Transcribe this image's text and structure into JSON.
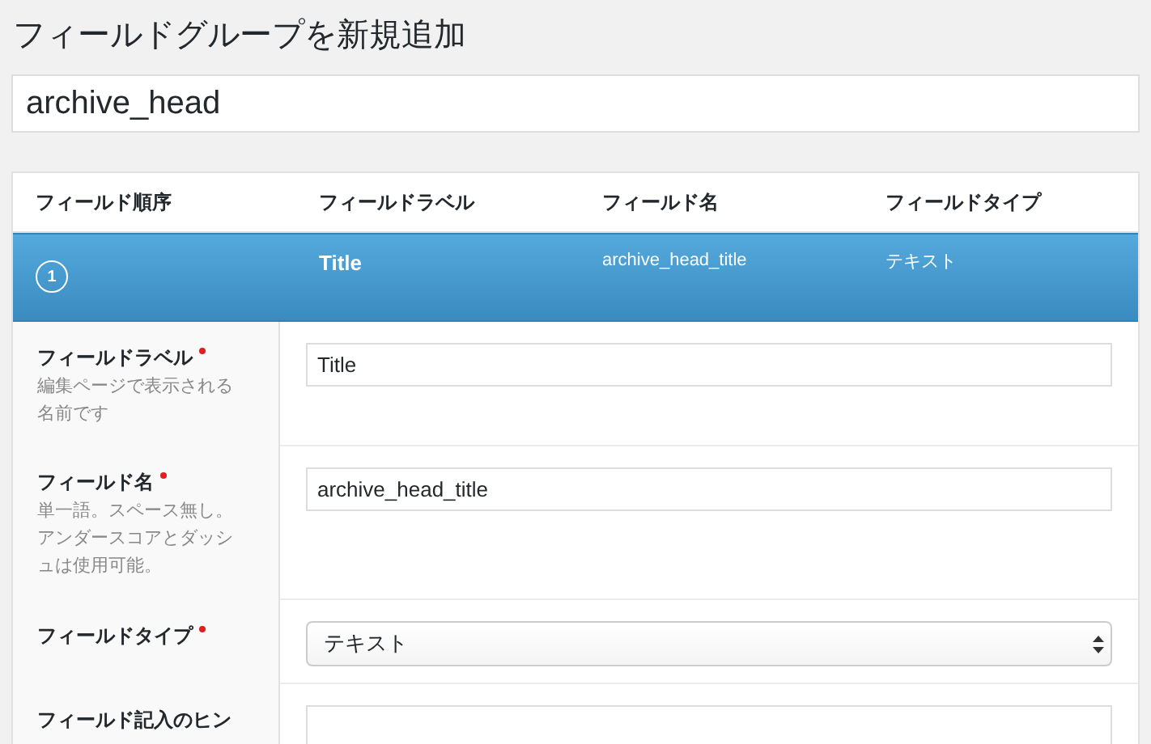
{
  "heading": "フィールドグループを新規追加",
  "group_title": {
    "value": "archive_head"
  },
  "table": {
    "columns": [
      "フィールド順序",
      "フィールドラベル",
      "フィールド名",
      "フィールドタイプ"
    ],
    "field": {
      "order": "1",
      "label": "Title",
      "name": "archive_head_title",
      "type": "テキスト",
      "selected": true
    }
  },
  "form_rows": [
    {
      "kind": "text",
      "label": "フィールドラベル",
      "required": true,
      "description": "編集ページで表示される名前です",
      "value": "Title"
    },
    {
      "kind": "text",
      "label": "フィールド名",
      "required": true,
      "description": "単一語。スペース無し。アンダースコアとダッシュは使用可能。",
      "value": "archive_head_title"
    },
    {
      "kind": "select",
      "label": "フィールドタイプ",
      "required": true,
      "value": "テキスト"
    },
    {
      "kind": "text",
      "label": "フィールド記入のヒン",
      "required": false
    }
  ]
}
